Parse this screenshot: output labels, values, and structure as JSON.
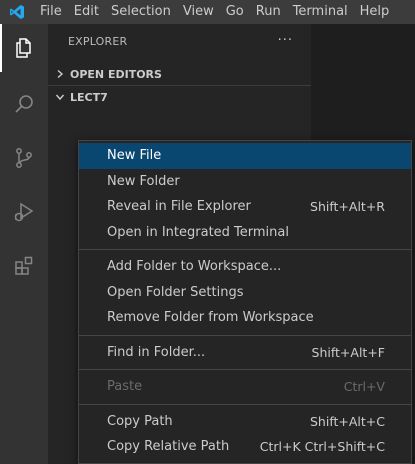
{
  "menubar": {
    "items": [
      "File",
      "Edit",
      "Selection",
      "View",
      "Go",
      "Run",
      "Terminal",
      "Help"
    ]
  },
  "activity_bar": {
    "icons": [
      "explorer-icon",
      "search-icon",
      "source-control-icon",
      "run-debug-icon",
      "extensions-icon"
    ]
  },
  "sidebar": {
    "title": "EXPLORER",
    "more": "···",
    "sections": [
      {
        "label": "OPEN EDITORS",
        "expanded": false
      },
      {
        "label": "LECT7",
        "expanded": true
      }
    ]
  },
  "context_menu": {
    "groups": [
      [
        {
          "label": "New File",
          "shortcut": "",
          "highlighted": true
        },
        {
          "label": "New Folder",
          "shortcut": ""
        },
        {
          "label": "Reveal in File Explorer",
          "shortcut": "Shift+Alt+R"
        },
        {
          "label": "Open in Integrated Terminal",
          "shortcut": ""
        }
      ],
      [
        {
          "label": "Add Folder to Workspace...",
          "shortcut": ""
        },
        {
          "label": "Open Folder Settings",
          "shortcut": ""
        },
        {
          "label": "Remove Folder from Workspace",
          "shortcut": ""
        }
      ],
      [
        {
          "label": "Find in Folder...",
          "shortcut": "Shift+Alt+F"
        }
      ],
      [
        {
          "label": "Paste",
          "shortcut": "Ctrl+V",
          "disabled": true
        }
      ],
      [
        {
          "label": "Copy Path",
          "shortcut": "Shift+Alt+C"
        },
        {
          "label": "Copy Relative Path",
          "shortcut": "Ctrl+K Ctrl+Shift+C"
        }
      ]
    ]
  },
  "colors": {
    "menubar_bg": "#3c3c3c",
    "activity_bg": "#333333",
    "sidebar_bg": "#252526",
    "highlight": "#094771",
    "logo": "#23a9f2"
  }
}
